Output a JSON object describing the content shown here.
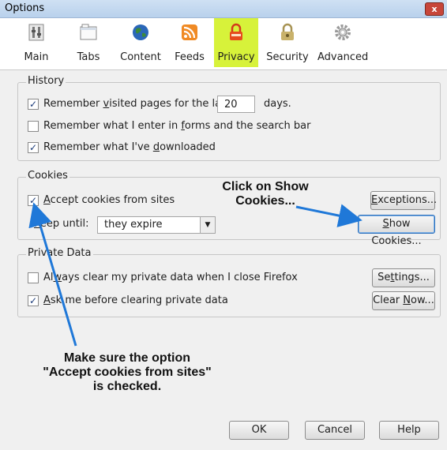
{
  "window": {
    "title": "Options",
    "close_label": "x"
  },
  "toolbar": {
    "items": [
      {
        "label": "Main",
        "icon": "main-switch-icon"
      },
      {
        "label": "Tabs",
        "icon": "tabs-icon"
      },
      {
        "label": "Content",
        "icon": "globe-icon"
      },
      {
        "label": "Feeds",
        "icon": "rss-feed-icon"
      },
      {
        "label": "Privacy",
        "icon": "padlock-mask-icon",
        "selected": true
      },
      {
        "label": "Security",
        "icon": "security-lock-icon"
      },
      {
        "label": "Advanced",
        "icon": "gear-icon"
      }
    ],
    "selected_color": "#d7f23a"
  },
  "history": {
    "title": "History",
    "remember_visited": {
      "pre": "Remember ",
      "u": "v",
      "post": "isited pages for the last",
      "checked": true
    },
    "days_value": "20",
    "days_label": "days.",
    "remember_forms": {
      "pre": "Remember what I enter in ",
      "u": "f",
      "post": "orms and the search bar",
      "checked": false
    },
    "remember_downloads": {
      "pre": "Remember what I've ",
      "u": "d",
      "post": "ownloaded",
      "checked": true
    }
  },
  "cookies": {
    "title": "Cookies",
    "accept": {
      "pre": "",
      "u": "A",
      "post": "ccept cookies from sites",
      "checked": true
    },
    "keep_label_pre": "",
    "keep_label_u": "K",
    "keep_label_post": "eep until:",
    "keep_value": "they expire",
    "exceptions": {
      "pre": "",
      "u": "E",
      "post": "xceptions..."
    },
    "show_cookies": {
      "pre": "",
      "u": "S",
      "post": "how Cookies..."
    }
  },
  "private_data": {
    "title": "Private Data",
    "always_clear": {
      "pre": "Al",
      "u": "w",
      "post": "ays clear my private data when I close Firefox",
      "checked": false
    },
    "ask_before": {
      "pre": "",
      "u": "A",
      "post": "sk me before clearing private data",
      "checked": true
    },
    "settings": {
      "pre": "Se",
      "u": "t",
      "post": "tings..."
    },
    "clear_now": {
      "pre": "Clear ",
      "u": "N",
      "post": "ow..."
    }
  },
  "footer": {
    "ok": "OK",
    "cancel": "Cancel",
    "help": "Help"
  },
  "annotations": {
    "show_cookies_note_line1": "Click on Show",
    "show_cookies_note_line2": "Cookies...",
    "accept_note_line1": "Make sure the option",
    "accept_note_line2": "\"Accept cookies from sites\"",
    "accept_note_line3": "is checked.",
    "arrow_color": "#1f78d8"
  }
}
